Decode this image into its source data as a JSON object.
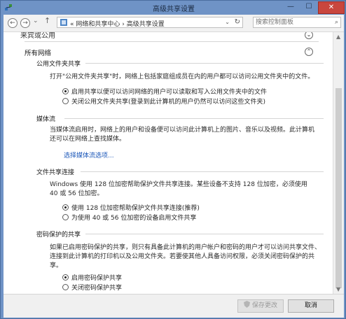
{
  "window": {
    "title": "高级共享设置",
    "minimize_glyph": "—",
    "maximize_glyph": "☐",
    "close_glyph": "✕"
  },
  "nav": {
    "back_glyph": "←",
    "forward_glyph": "→",
    "recent_glyph": "⌄",
    "up_glyph": "↑",
    "breadcrumb": "« 网络和共享中心 › 高级共享设置",
    "dropdown_glyph": "⌄",
    "refresh_glyph": "↻",
    "search_placeholder": "搜索控制面板",
    "search_icon": "search-icon"
  },
  "content": {
    "cut_header": "来宾或公用",
    "section_title": "所有网络",
    "public_folder": {
      "title": "公用文件夹共享",
      "desc": "打开\"公用文件夹共享\"时，网络上包括家庭组成员在内的用户都可以访问公用文件夹中的文件。",
      "options": [
        {
          "label": "启用共享以便可以访问网络的用户可以读取和写入公用文件夹中的文件",
          "selected": true
        },
        {
          "label": "关闭公用文件夹共享(登录到此计算机的用户仍然可以访问这些文件夹)",
          "selected": false
        }
      ]
    },
    "media_stream": {
      "title": "媒体流",
      "desc": "当媒体流启用时，网络上的用户和设备便可以访问此计算机上的图片、音乐以及视频。此计算机还可以在网络上查找媒体。",
      "link": "选择媒体流选项..."
    },
    "file_sharing": {
      "title": "文件共享连接",
      "desc": "Windows 使用 128 位加密帮助保护文件共享连接。某些设备不支持 128 位加密，必须使用 40 或 56 位加密。",
      "options": [
        {
          "label": "使用 128 位加密帮助保护文件共享连接(推荐)",
          "selected": true
        },
        {
          "label": "为使用 40 或 56 位加密的设备启用文件共享",
          "selected": false
        }
      ]
    },
    "password_sharing": {
      "title": "密码保护的共享",
      "desc": "如果已启用密码保护的共享，则只有具备此计算机的用户帐户和密码的用户才可以访问共享文件、连接到此计算机的打印机以及公用文件夹。若要使其他人具备访问权限，必须关闭密码保护的共享。",
      "options": [
        {
          "label": "启用密码保护共享",
          "selected": true
        },
        {
          "label": "关闭密码保护共享",
          "selected": false
        }
      ]
    }
  },
  "footer": {
    "save_label": "保存更改",
    "cancel_label": "取消"
  },
  "colors": {
    "frame": "#6f93c6",
    "link": "#1a56b8",
    "close": "#c9463d"
  }
}
